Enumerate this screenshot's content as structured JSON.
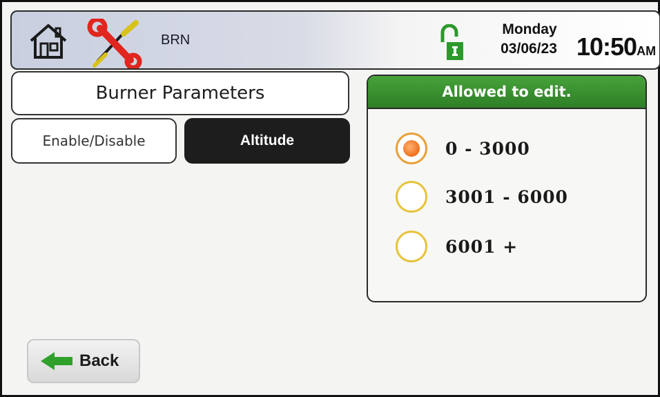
{
  "header": {
    "home_icon": "home-icon",
    "tools_icon": "wrench-screwdriver-icon",
    "app_code": "BRN",
    "lock_icon": "unlocked-padlock-icon",
    "day": "Monday",
    "date": "03/06/23",
    "time": "10:50",
    "ampm": "AM"
  },
  "page": {
    "title": "Burner Parameters",
    "tabs": [
      {
        "label": "Enable/Disable",
        "active": false
      },
      {
        "label": "Altitude",
        "active": true
      }
    ]
  },
  "edit_panel": {
    "header": "Allowed to edit.",
    "options": [
      {
        "label": "0 - 3000",
        "selected": true
      },
      {
        "label": "3001 - 6000",
        "selected": false
      },
      {
        "label": "6001 +",
        "selected": false
      }
    ]
  },
  "footer": {
    "back_label": "Back",
    "back_icon": "left-arrow-icon"
  },
  "colors": {
    "accent_green": "#2e7f26",
    "radio_orange": "#ef6f1c",
    "radio_ring": "#e7c33a",
    "active_tab": "#1d1d1d"
  }
}
